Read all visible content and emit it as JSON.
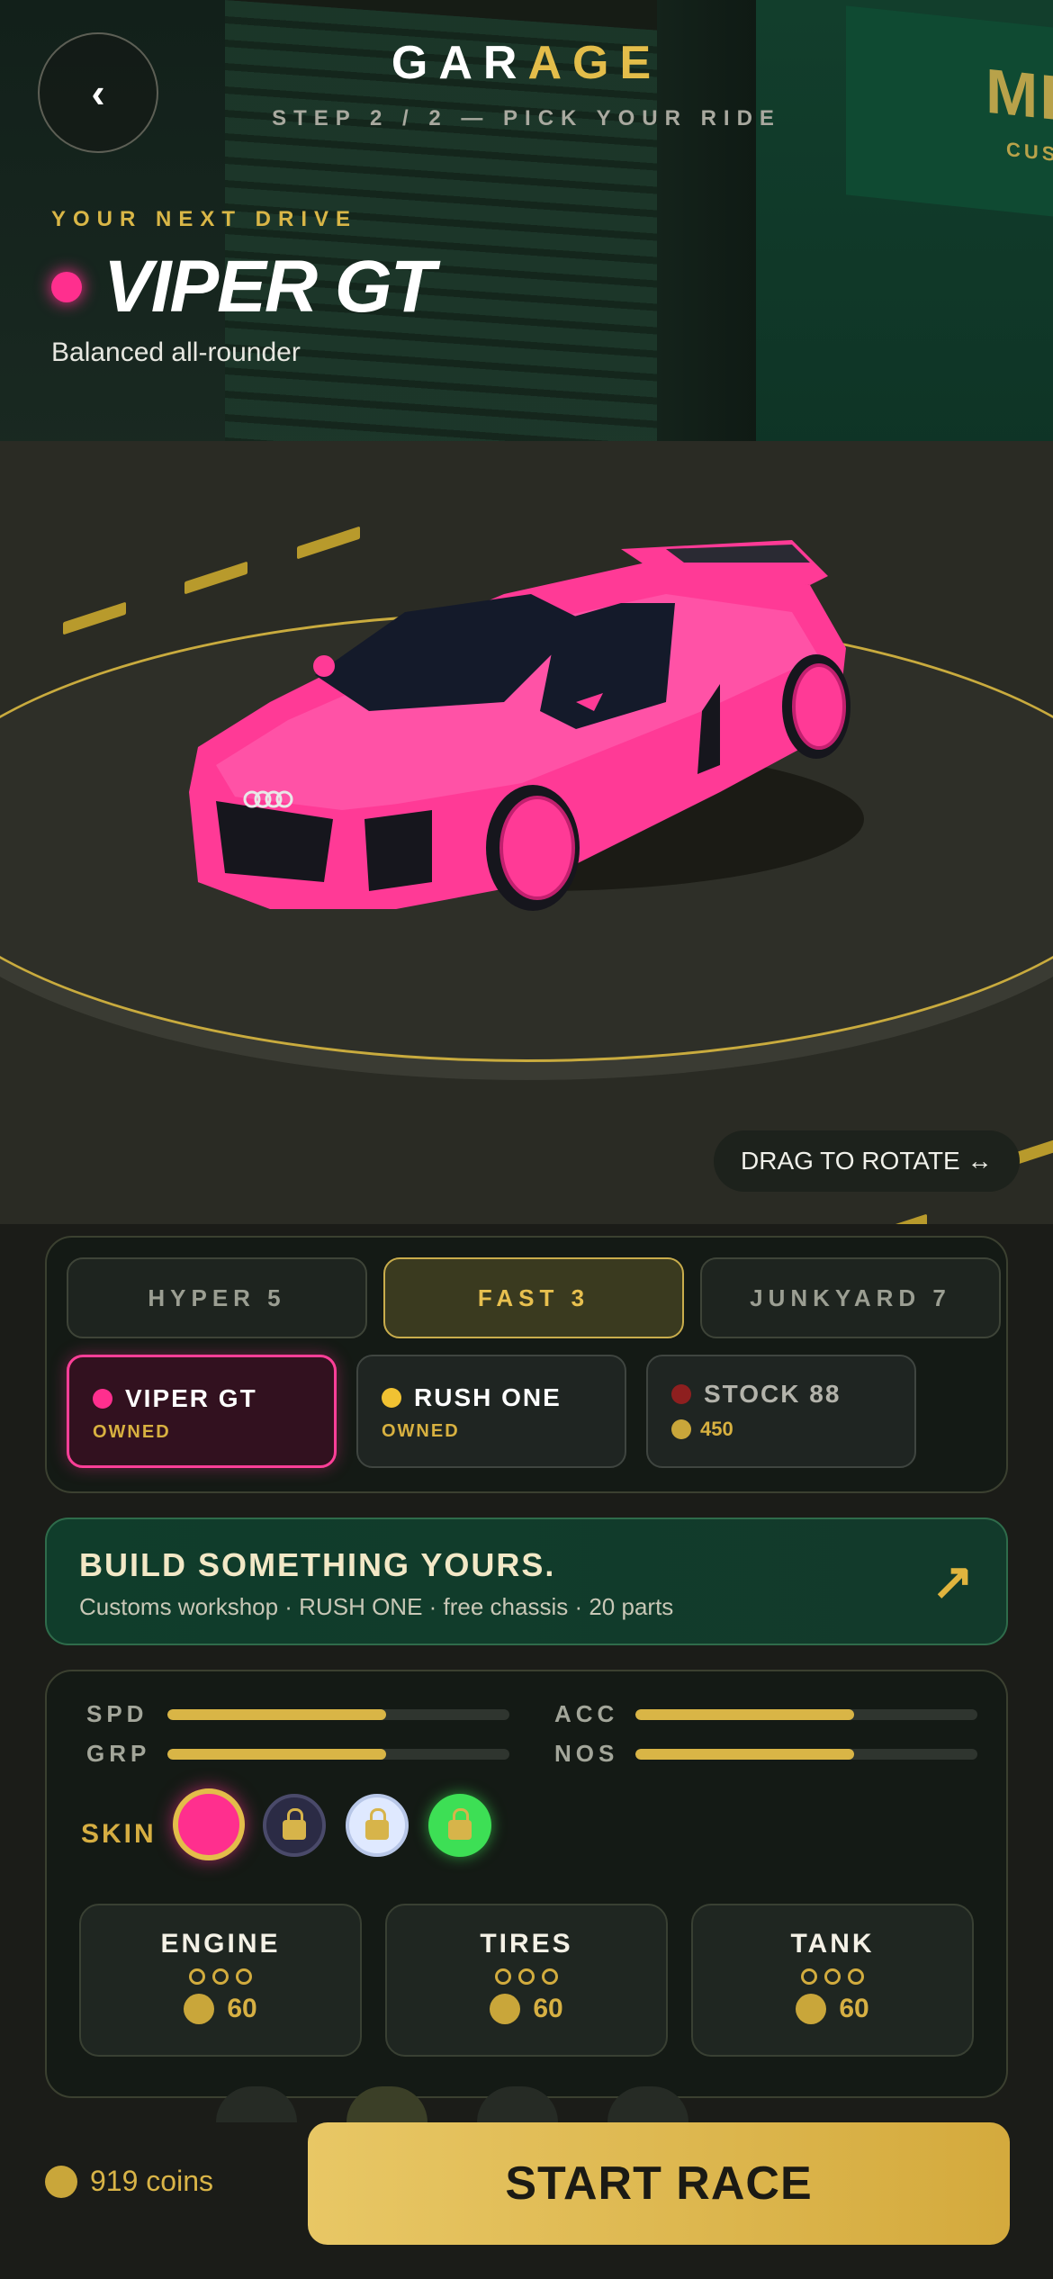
{
  "header": {
    "back_icon": "‹",
    "title_white": "GAR",
    "title_yellow": "AGE",
    "subtitle": "STEP 2 / 2 — PICK YOUR RIDE"
  },
  "scene": {
    "sign_big": "MI",
    "sign_small": "CUS"
  },
  "selected_car": {
    "label": "YOUR NEXT DRIVE",
    "name": "VIPER GT",
    "tagline": "Balanced all-rounder",
    "color": "#ff2f8e"
  },
  "rotate_hint": "DRAG TO ROTATE ↔",
  "tiers": [
    {
      "label": "HYPER 5",
      "active": false
    },
    {
      "label": "FAST 3",
      "active": true
    },
    {
      "label": "JUNKYARD 7",
      "active": false
    }
  ],
  "cars": [
    {
      "name": "VIPER GT",
      "status": "OWNED",
      "color": "#ff2f8e",
      "selected": true
    },
    {
      "name": "RUSH ONE",
      "status": "OWNED",
      "color": "#f1c232",
      "selected": false
    },
    {
      "name": "STOCK 88",
      "price": "450",
      "color": "#8e1f1f",
      "selected": false
    }
  ],
  "promo": {
    "title": "BUILD SOMETHING YOURS.",
    "subtitle": "Customs workshop · RUSH ONE · free chassis · 20 parts",
    "arrow_icon": "↗"
  },
  "stats": [
    {
      "label": "SPD",
      "value": 0.64
    },
    {
      "label": "ACC",
      "value": 0.64
    },
    {
      "label": "GRP",
      "value": 0.64
    },
    {
      "label": "NOS",
      "value": 0.64
    }
  ],
  "skins": {
    "label": "SKIN",
    "options": [
      {
        "color": "#ff2f8e",
        "locked": false,
        "selected": true
      },
      {
        "color": "#2b2b45",
        "locked": true,
        "selected": false
      },
      {
        "color": "#dfe9ff",
        "locked": true,
        "selected": false
      },
      {
        "color": "#3ddf55",
        "locked": true,
        "selected": false
      }
    ]
  },
  "upgrades": [
    {
      "name": "ENGINE",
      "cost": "60"
    },
    {
      "name": "TIRES",
      "cost": "60"
    },
    {
      "name": "TANK",
      "cost": "60"
    }
  ],
  "footer": {
    "coins": "919 coins",
    "start_label": "START RACE"
  },
  "colors": {
    "accent": "#e3bd4a",
    "pink": "#ff2f8e",
    "panel": "#141a15",
    "promo": "#103d2b"
  }
}
